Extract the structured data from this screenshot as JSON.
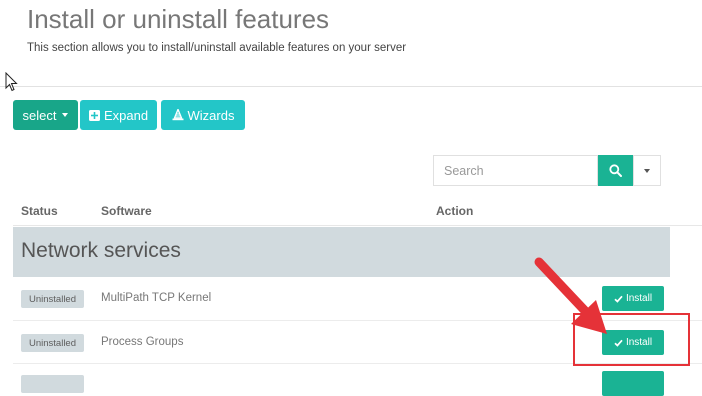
{
  "header": {
    "title": "Install or uninstall features",
    "subtitle": "This section allows you to install/uninstall available features on your server"
  },
  "toolbar": {
    "select_label": "select",
    "expand_label": "Expand",
    "wizards_label": "Wizards"
  },
  "search": {
    "placeholder": "Search",
    "value": ""
  },
  "table": {
    "columns": [
      "Status",
      "Software",
      "Action"
    ],
    "group_title": "Network services",
    "rows": [
      {
        "status": "Uninstalled",
        "software": "MultiPath TCP Kernel",
        "action": "Install"
      },
      {
        "status": "Uninstalled",
        "software": "Process Groups",
        "action": "Install"
      }
    ]
  },
  "colors": {
    "primary": "#1ab394",
    "info": "#23c6c8",
    "highlight": "#e53238",
    "group_bg": "#d1dade"
  },
  "icons": [
    "plus-square-icon",
    "wizard-hat-icon",
    "search-icon",
    "check-icon",
    "mouse-cursor-icon",
    "annotation-arrow-icon"
  ]
}
